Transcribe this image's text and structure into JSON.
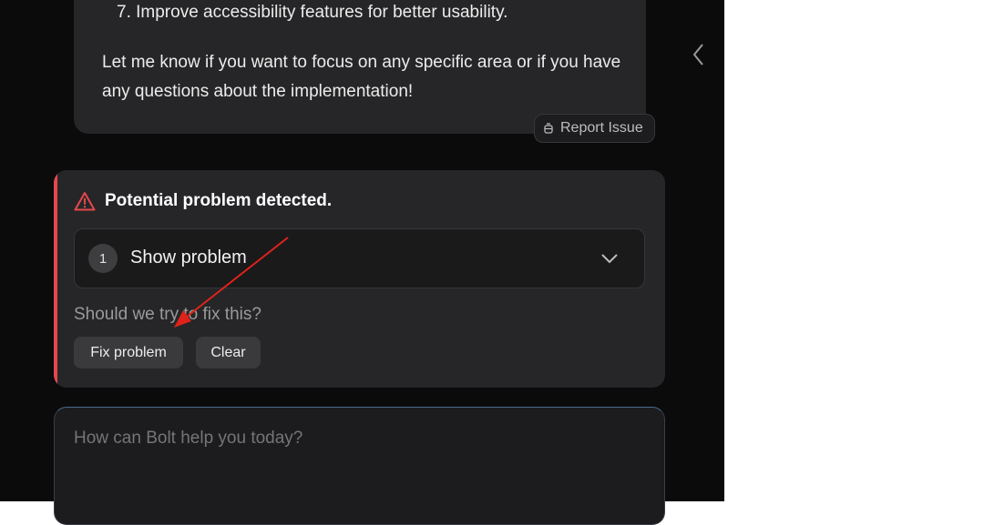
{
  "message": {
    "list_item": "7. Improve accessibility features for better usability.",
    "paragraph": "Let me know if you want to focus on any specific area or if you have any questions about the implementation!",
    "report_button": "Report Issue"
  },
  "alert": {
    "title": "Potential problem detected.",
    "step_number": "1",
    "toggle_label": "Show problem",
    "question": "Should we try to fix this?",
    "fix_button": "Fix problem",
    "clear_button": "Clear"
  },
  "composer": {
    "placeholder": "How can Bolt help you today?"
  },
  "colors": {
    "background": "#0b0b0c",
    "card": "#262628",
    "alert_accent": "#e5484d",
    "annotation_arrow": "#e0221b"
  },
  "icons": [
    "bug-icon",
    "chevron-left-icon",
    "warning-icon",
    "chevron-down-icon"
  ]
}
